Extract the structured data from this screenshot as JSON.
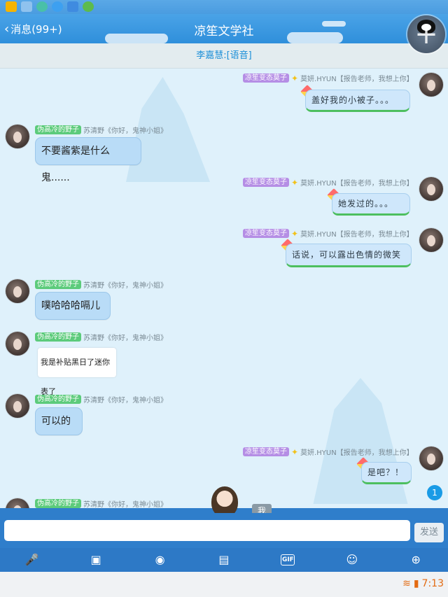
{
  "header": {
    "back_label": "消息(99+)",
    "title": "凉笙文学社"
  },
  "voice_banner": "李嘉慧:[语音]",
  "messages": [
    {
      "side": "right",
      "tag": "凉笙变态莫子",
      "name": "莫妍.HYUN【报告老师，我想上你】",
      "text": "盖好我的小被子。。。"
    },
    {
      "side": "left",
      "tag": "伪高冷的野子",
      "name": "苏清野《你好，鬼神小姐》",
      "text": "不要酱紫是什么鬼......"
    },
    {
      "side": "right",
      "tag": "凉笙变态莫子",
      "name": "莫妍.HYUN【报告老师，我想上你】",
      "text": "她发过的。。。"
    },
    {
      "side": "right",
      "tag": "凉笙变态莫子",
      "name": "莫妍.HYUN【报告老师，我想上你】",
      "text": "话说，可以露出色情的微笑"
    },
    {
      "side": "left",
      "tag": "伪高冷的野子",
      "name": "苏清野《你好，鬼神小姐》",
      "text": "噗哈哈哈嗝儿"
    },
    {
      "side": "left",
      "tag": "伪高冷的野子",
      "name": "苏清野《你好，鬼神小姐》",
      "text": "我是补贴黑日了迷你表了",
      "sticker": true
    },
    {
      "side": "left",
      "tag": "伪高冷的野子",
      "name": "苏清野《你好，鬼神小姐》",
      "text": "可以的"
    },
    {
      "side": "right",
      "tag": "凉笙变态莫子",
      "name": "莫妍.HYUN【报告老师，我想上你】",
      "text": "是吧？！"
    },
    {
      "side": "left",
      "tag": "伪高冷的野子",
      "name": "苏清野《你好，鬼神小姐》",
      "text": ""
    }
  ],
  "unread_count": "1",
  "me_label": "我",
  "input": {
    "placeholder": "",
    "value": ""
  },
  "send_label": "发送",
  "toolbar": {
    "items": [
      "mic-icon",
      "photo-icon",
      "camera-icon",
      "file-icon",
      "gif-icon",
      "emoji-icon",
      "plus-icon"
    ],
    "gif_label": "GIF"
  },
  "status": {
    "time": "7:13"
  },
  "colors": {
    "accent": "#2f7ecb",
    "bubble_left": "#b9dcf7",
    "bubble_right": "#cfe7fb",
    "tag_green": "#5ccb7b",
    "tag_purple": "#b58ee5"
  }
}
